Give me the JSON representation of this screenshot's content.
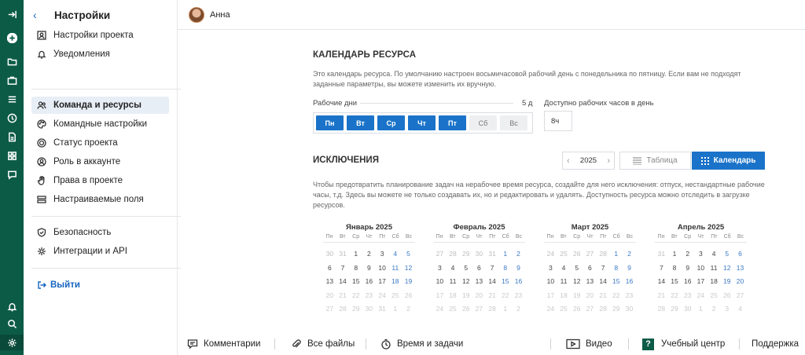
{
  "rail": {
    "icons": [
      "collapse-icon",
      "add-icon",
      "folder-icon",
      "briefcase-icon",
      "list-icon",
      "clock-icon",
      "document-icon",
      "apps-icon",
      "chat-icon",
      "bell-icon",
      "search-icon",
      "settings-icon"
    ]
  },
  "sidebar": {
    "title": "Настройки",
    "group1": [
      {
        "label": "Настройки проекта",
        "icon": "project-settings-icon"
      },
      {
        "label": "Уведомления",
        "icon": "bell-icon"
      }
    ],
    "group2": [
      {
        "label": "Команда и ресурсы",
        "icon": "team-icon",
        "active": true
      },
      {
        "label": "Командные настройки",
        "icon": "palette-icon"
      },
      {
        "label": "Статус проекта",
        "icon": "status-icon"
      },
      {
        "label": "Роль в аккаунте",
        "icon": "user-icon"
      },
      {
        "label": "Права в проекте",
        "icon": "hand-icon"
      },
      {
        "label": "Настраиваемые поля",
        "icon": "fields-icon"
      }
    ],
    "group3": [
      {
        "label": "Безопасность",
        "icon": "shield-icon"
      },
      {
        "label": "Интеграции и API",
        "icon": "integration-icon"
      }
    ],
    "logout": "Выйти"
  },
  "topbar": {
    "user_name": "Анна"
  },
  "calendar": {
    "title": "КАЛЕНДАРЬ РЕСУРСА",
    "description": "Это календарь ресурса. По умолчанию настроен восьмичасовой рабочий день с понедельника по пятницу. Если вам не подходят заданные параметры, вы можете изменить их вручную.",
    "workdays_label": "Рабочие дни",
    "workdays_count": "5 д",
    "days": [
      {
        "label": "Пн",
        "on": true
      },
      {
        "label": "Вт",
        "on": true
      },
      {
        "label": "Ср",
        "on": true
      },
      {
        "label": "Чт",
        "on": true
      },
      {
        "label": "Пт",
        "on": true
      },
      {
        "label": "Сб",
        "on": false
      },
      {
        "label": "Вс",
        "on": false
      }
    ],
    "hours_label": "Доступно рабочих часов в день",
    "hours_value": "8ч"
  },
  "exceptions": {
    "title": "ИСКЛЮЧЕНИЯ",
    "year": "2025",
    "view_table": "Таблица",
    "view_calendar": "Календарь",
    "description": "Чтобы предотвратить планирование задач на нерабочее время ресурса, создайте для него исключения: отпуск, нестандартные рабочие часы, т.д. Здесь вы можете не только создавать их, но и редактировать и удалять. Доступность ресурса можно отследить в загрузке ресурсов.",
    "weekdays": [
      "Пн",
      "Вт",
      "Ср",
      "Чт",
      "Пт",
      "Сб",
      "Вс"
    ],
    "months": [
      {
        "name": "Январь 2025",
        "weeks": [
          [
            "30",
            "31",
            "1",
            "2",
            "3",
            "4",
            "5"
          ],
          [
            "6",
            "7",
            "8",
            "9",
            "10",
            "11",
            "12"
          ],
          [
            "13",
            "14",
            "15",
            "16",
            "17",
            "18",
            "19"
          ],
          [
            "20",
            "21",
            "22",
            "23",
            "24",
            "25",
            "26"
          ],
          [
            "27",
            "28",
            "29",
            "30",
            "31",
            "1",
            "2"
          ]
        ],
        "lead": 2
      },
      {
        "name": "Февраль 2025",
        "weeks": [
          [
            "27",
            "28",
            "29",
            "30",
            "31",
            "1",
            "2"
          ],
          [
            "3",
            "4",
            "5",
            "6",
            "7",
            "8",
            "9"
          ],
          [
            "10",
            "11",
            "12",
            "13",
            "14",
            "15",
            "16"
          ],
          [
            "17",
            "18",
            "19",
            "20",
            "21",
            "22",
            "23"
          ],
          [
            "24",
            "25",
            "26",
            "27",
            "28",
            "1",
            "2"
          ]
        ],
        "lead": 5
      },
      {
        "name": "Март 2025",
        "weeks": [
          [
            "24",
            "25",
            "26",
            "27",
            "28",
            "1",
            "2"
          ],
          [
            "3",
            "4",
            "5",
            "6",
            "7",
            "8",
            "9"
          ],
          [
            "10",
            "11",
            "12",
            "13",
            "14",
            "15",
            "16"
          ],
          [
            "17",
            "18",
            "19",
            "20",
            "21",
            "22",
            "23"
          ],
          [
            "24",
            "25",
            "26",
            "27",
            "28",
            "29",
            "30"
          ]
        ],
        "lead": 5
      },
      {
        "name": "Апрель 2025",
        "weeks": [
          [
            "31",
            "1",
            "2",
            "3",
            "4",
            "5",
            "6"
          ],
          [
            "7",
            "8",
            "9",
            "10",
            "11",
            "12",
            "13"
          ],
          [
            "14",
            "15",
            "16",
            "17",
            "18",
            "19",
            "20"
          ],
          [
            "21",
            "22",
            "23",
            "24",
            "25",
            "26",
            "27"
          ],
          [
            "28",
            "29",
            "30",
            "1",
            "2",
            "3",
            "4"
          ]
        ],
        "lead": 1
      }
    ]
  },
  "bottombar": {
    "comments": "Комментарии",
    "files": "Все файлы",
    "time": "Время и задачи",
    "video": "Видео",
    "help": "Учебный центр",
    "support": "Поддержка"
  }
}
